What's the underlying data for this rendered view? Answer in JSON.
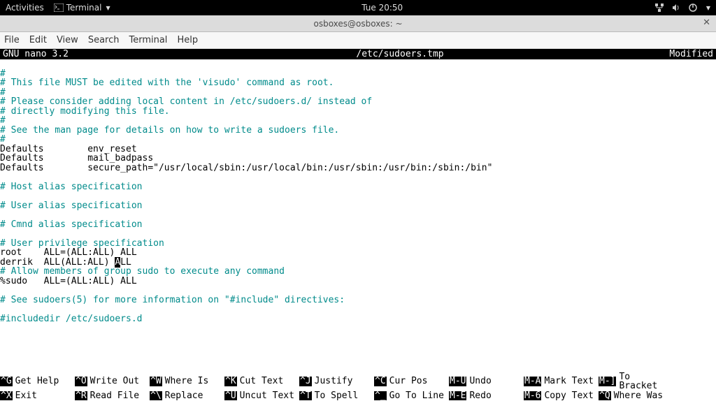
{
  "topbar": {
    "activities": "Activities",
    "app_icon": "terminal-icon",
    "app_name": "Terminal",
    "clock": "Tue 20:50"
  },
  "window": {
    "title": "osboxes@osboxes: ~"
  },
  "menubar": {
    "items": [
      "File",
      "Edit",
      "View",
      "Search",
      "Terminal",
      "Help"
    ]
  },
  "nano": {
    "header_left": "  GNU nano 3.2",
    "header_center": "/etc/sudoers.tmp",
    "header_right": "Modified  "
  },
  "editor_lines": [
    {
      "cls": "comment",
      "text": "#"
    },
    {
      "cls": "comment",
      "text": "# This file MUST be edited with the 'visudo' command as root."
    },
    {
      "cls": "comment",
      "text": "#"
    },
    {
      "cls": "comment",
      "text": "# Please consider adding local content in /etc/sudoers.d/ instead of"
    },
    {
      "cls": "comment",
      "text": "# directly modifying this file."
    },
    {
      "cls": "comment",
      "text": "#"
    },
    {
      "cls": "comment",
      "text": "# See the man page for details on how to write a sudoers file."
    },
    {
      "cls": "comment",
      "text": "#"
    },
    {
      "cls": "normal",
      "text": "Defaults        env_reset"
    },
    {
      "cls": "normal",
      "text": "Defaults        mail_badpass"
    },
    {
      "cls": "normal",
      "text": "Defaults        secure_path=\"/usr/local/sbin:/usr/local/bin:/usr/sbin:/usr/bin:/sbin:/bin\""
    },
    {
      "cls": "normal",
      "text": ""
    },
    {
      "cls": "comment",
      "text": "# Host alias specification"
    },
    {
      "cls": "normal",
      "text": ""
    },
    {
      "cls": "comment",
      "text": "# User alias specification"
    },
    {
      "cls": "normal",
      "text": ""
    },
    {
      "cls": "comment",
      "text": "# Cmnd alias specification"
    },
    {
      "cls": "normal",
      "text": ""
    },
    {
      "cls": "comment",
      "text": "# User privilege specification"
    },
    {
      "cls": "normal",
      "text": "root    ALL=(ALL:ALL) ALL"
    },
    {
      "cls": "cursorline",
      "before": "derrik  ALL(ALL:ALL) ",
      "cursor": "A",
      "after": "LL"
    },
    {
      "cls": "comment",
      "text": "# Allow members of group sudo to execute any command"
    },
    {
      "cls": "normal",
      "text": "%sudo   ALL=(ALL:ALL) ALL"
    },
    {
      "cls": "normal",
      "text": ""
    },
    {
      "cls": "comment",
      "text": "# See sudoers(5) for more information on \"#include\" directives:"
    },
    {
      "cls": "normal",
      "text": ""
    },
    {
      "cls": "comment",
      "text": "#includedir /etc/sudoers.d"
    }
  ],
  "shortcuts_row1": [
    {
      "key": "^G",
      "label": "Get Help"
    },
    {
      "key": "^O",
      "label": "Write Out"
    },
    {
      "key": "^W",
      "label": "Where Is"
    },
    {
      "key": "^K",
      "label": "Cut Text"
    },
    {
      "key": "^J",
      "label": "Justify"
    },
    {
      "key": "^C",
      "label": "Cur Pos"
    },
    {
      "key": "M-U",
      "label": "Undo"
    },
    {
      "key": "M-A",
      "label": "Mark Text"
    },
    {
      "key": "M-]",
      "label": "To Bracket"
    }
  ],
  "shortcuts_row2": [
    {
      "key": "^X",
      "label": "Exit"
    },
    {
      "key": "^R",
      "label": "Read File"
    },
    {
      "key": "^\\",
      "label": "Replace"
    },
    {
      "key": "^U",
      "label": "Uncut Text"
    },
    {
      "key": "^T",
      "label": "To Spell"
    },
    {
      "key": "^_",
      "label": "Go To Line"
    },
    {
      "key": "M-E",
      "label": "Redo"
    },
    {
      "key": "M-6",
      "label": "Copy Text"
    },
    {
      "key": "^Q",
      "label": "Where Was"
    }
  ]
}
